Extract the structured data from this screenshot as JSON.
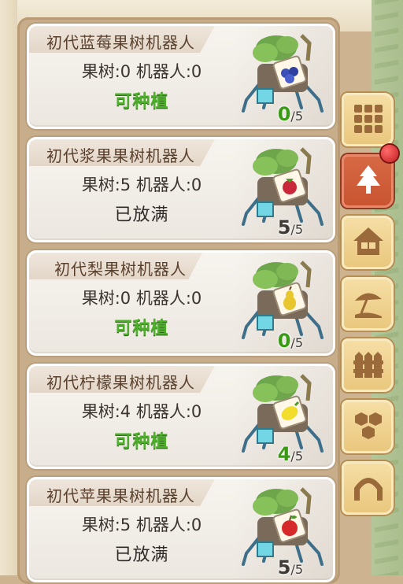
{
  "cards": [
    {
      "title": "初代蓝莓果树机器人",
      "counts": "果树:0 机器人:0",
      "status": "可种植",
      "status_type": "plantable",
      "ratio_num": "0",
      "ratio_den": "/5",
      "fruit": "blueberry-icon"
    },
    {
      "title": "初代浆果果树机器人",
      "counts": "果树:5 机器人:0",
      "status": "已放满",
      "status_type": "full",
      "ratio_num": "5",
      "ratio_den": "/5",
      "fruit": "raspberry-icon"
    },
    {
      "title": "初代梨果树机器人",
      "counts": "果树:0 机器人:0",
      "status": "可种植",
      "status_type": "plantable",
      "ratio_num": "0",
      "ratio_den": "/5",
      "fruit": "pear-icon"
    },
    {
      "title": "初代柠檬果树机器人",
      "counts": "果树:4 机器人:0",
      "status": "可种植",
      "status_type": "plantable",
      "ratio_num": "4",
      "ratio_den": "/5",
      "fruit": "lemon-icon"
    },
    {
      "title": "初代苹果果树机器人",
      "counts": "果树:5 机器人:0",
      "status": "已放满",
      "status_type": "full",
      "ratio_num": "5",
      "ratio_den": "/5",
      "fruit": "apple-icon"
    }
  ],
  "side_tabs": [
    {
      "icon": "grid-icon",
      "active": false
    },
    {
      "icon": "tree-icon",
      "active": true
    },
    {
      "icon": "house-icon",
      "active": false
    },
    {
      "icon": "umbrella-icon",
      "active": false
    },
    {
      "icon": "fence-icon",
      "active": false
    },
    {
      "icon": "hexagon-icon",
      "active": false
    },
    {
      "icon": "arch-icon",
      "active": false
    }
  ],
  "colors": {
    "plantable": "#4caf2a",
    "active_tab": "#c8532f",
    "tab": "#e9c67c"
  }
}
